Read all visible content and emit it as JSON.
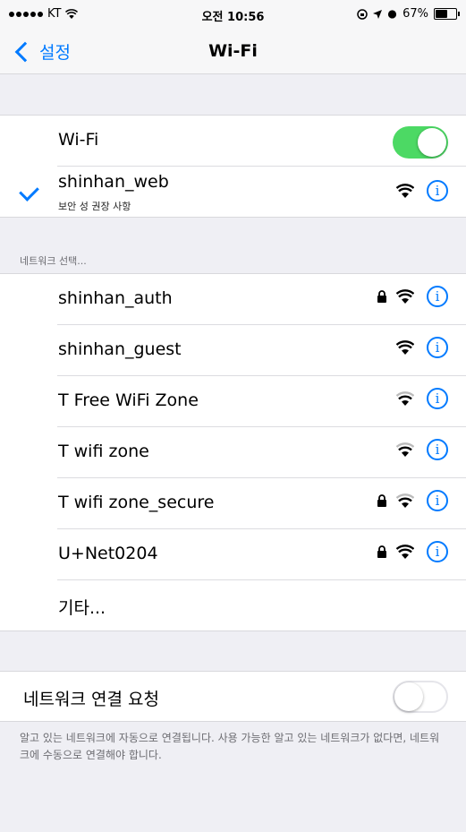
{
  "status_bar": {
    "carrier": "KT",
    "time": "오전 10:56",
    "battery_percent": "67%",
    "battery_level": 0.67
  },
  "nav": {
    "back_label": "설정",
    "title": "Wi-Fi"
  },
  "wifi_toggle": {
    "label": "Wi-Fi",
    "on": true
  },
  "connected": {
    "ssid": "shinhan_web",
    "subtitle": "보안 성 권장 사항"
  },
  "section_header": "네트워크 선택...",
  "networks": [
    {
      "ssid": "shinhan_auth",
      "locked": true
    },
    {
      "ssid": "shinhan_guest",
      "locked": false
    },
    {
      "ssid": "T Free WiFi Zone",
      "locked": false
    },
    {
      "ssid": "T wifi zone",
      "locked": false
    },
    {
      "ssid": "T wifi zone_secure",
      "locked": true
    },
    {
      "ssid": "U+Net0204",
      "locked": true
    }
  ],
  "other_label": "기타...",
  "ask_to_join": {
    "label": "네트워크 연결 요청",
    "on": false
  },
  "footer": "알고 있는 네트워크에 자동으로 연결됩니다. 사용 가능한 알고 있는 네트워크가 없다면, 네트워크에 수동으로 연결해야 합니다.",
  "colors": {
    "accent": "#007aff",
    "toggle_on": "#4cd964"
  }
}
